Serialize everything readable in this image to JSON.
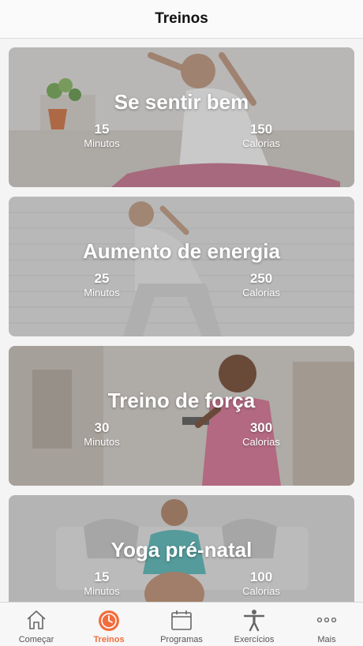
{
  "header": {
    "title": "Treinos"
  },
  "workouts": [
    {
      "title": "Se sentir bem",
      "minutes": "15",
      "minutes_label": "Minutos",
      "calories": "150",
      "calories_label": "Calorias"
    },
    {
      "title": "Aumento de energia",
      "minutes": "25",
      "minutes_label": "Minutos",
      "calories": "250",
      "calories_label": "Calorias"
    },
    {
      "title": "Treino de força",
      "minutes": "30",
      "minutes_label": "Minutos",
      "calories": "300",
      "calories_label": "Calorias"
    },
    {
      "title": "Yoga pré-natal",
      "minutes": "15",
      "minutes_label": "Minutos",
      "calories": "100",
      "calories_label": "Calorias"
    }
  ],
  "tabbar": {
    "items": [
      {
        "label": "Começar",
        "icon": "home-icon"
      },
      {
        "label": "Treinos",
        "icon": "stopwatch-icon",
        "active": true
      },
      {
        "label": "Programas",
        "icon": "calendar-icon"
      },
      {
        "label": "Exercícios",
        "icon": "person-icon"
      },
      {
        "label": "Mais",
        "icon": "more-icon"
      }
    ]
  },
  "colors": {
    "accent": "#f26d3d",
    "background": "#f4f4f4"
  }
}
